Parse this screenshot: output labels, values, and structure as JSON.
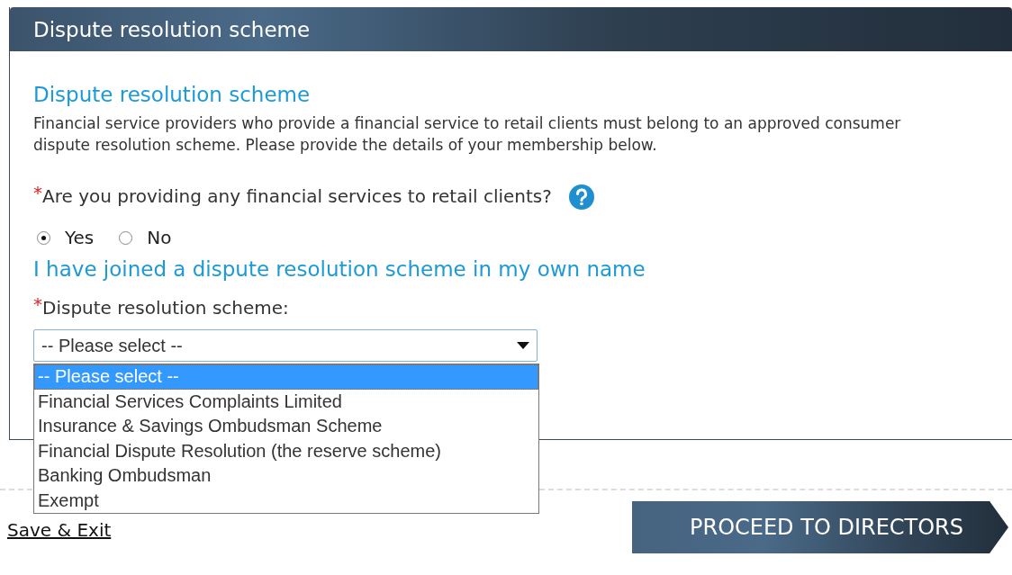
{
  "panel": {
    "title": "Dispute resolution scheme"
  },
  "section": {
    "heading": "Dispute resolution scheme",
    "description": "Financial service providers who provide a financial service to retail clients must belong to an approved consumer dispute resolution scheme. Please provide the details of your membership below."
  },
  "question": {
    "required_mark": "*",
    "label": "Are you providing any financial services to retail clients?",
    "options": [
      {
        "label": "Yes",
        "selected": true
      },
      {
        "label": "No",
        "selected": false
      }
    ]
  },
  "subheading": "I have joined a dispute resolution scheme in my own name",
  "scheme_field": {
    "required_mark": "*",
    "label": "Dispute resolution scheme:",
    "value": "-- Please select --",
    "expanded": true,
    "options": [
      {
        "label": "-- Please select --",
        "selected": true
      },
      {
        "label": "Financial Services Complaints Limited",
        "selected": false
      },
      {
        "label": "Insurance & Savings Ombudsman Scheme",
        "selected": false
      },
      {
        "label": "Financial Dispute Resolution (the reserve scheme)",
        "selected": false
      },
      {
        "label": "Banking Ombudsman",
        "selected": false
      },
      {
        "label": "Exempt",
        "selected": false
      }
    ]
  },
  "save_link": "Save & Exit",
  "proceed_button": "PROCEED TO DIRECTORS"
}
